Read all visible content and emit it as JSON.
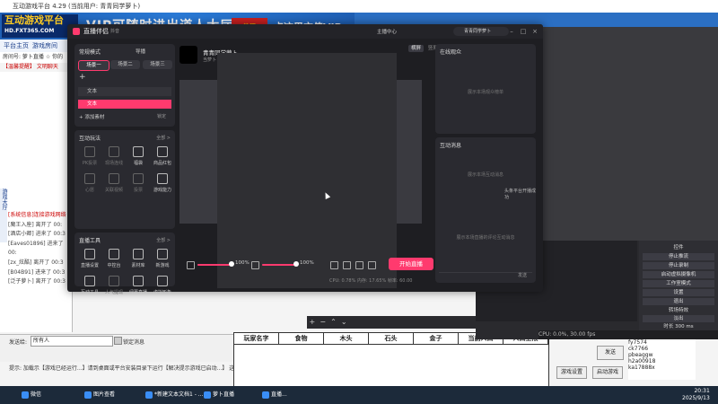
{
  "bg": {
    "window_title": "互动游戏平台 4.29 (当前用户: 青青同学萝卜)",
    "logo_text": "互动游戏平台",
    "logo_sub": "HD.FXT365.COM",
    "slogan": "VIP可随时进出道人大厅",
    "slogan_badge": "热门",
    "slogan_right": "点这里充值VIP",
    "nav_home": "平台主页",
    "nav_game": "游戏房间",
    "room_line": "房间号: 萝卜直播 ☆ 你的",
    "notice": "【温馨提醒】 文明聊天",
    "side_tab": "游戏大厅",
    "chat": [
      "[系统信息]连接游戏网络",
      "[魔王入座] 离开了 00:",
      "[酒店小卿] 进来了 00:3",
      "[Eaves01896] 进来了 00:",
      "[zx_炫酷] 离开了 00:3",
      "[B04B91] 进来了 00:3",
      "[泛子萝卜] 离开了 00:3"
    ],
    "send_target_label": "发送给:",
    "send_target_value": "所有人",
    "lock_label": "锁定消息",
    "tip": "提示: 加载示【游戏已经运行...】请到桌面或平台安装目录下运行【解决提示游戏已启动...】 这个文件",
    "score_headers": [
      "玩家名字",
      "食物",
      "木头",
      "石头",
      "金子",
      "当前人口",
      "人口上限"
    ],
    "obs_controls": [
      "控件",
      "停止推流",
      "停止录制",
      "启动虚拟摄像机",
      "工作室模式",
      "设置",
      "退出"
    ],
    "obs_status": "CPU: 0.0%, 30.00 fps",
    "obs_transition_label": "转场特效",
    "obs_transition_value": "淡出",
    "obs_duration": "时长 300 ms",
    "players": [
      "fy7574",
      "ck7766",
      "pbeaggw",
      "h2a00918",
      "ka17888x"
    ],
    "btn_game_settings": "游戏设置",
    "btn_start_game": "启动游戏",
    "btn_confirm": "发送"
  },
  "taskbar": {
    "items": [
      "微信",
      "图片查看",
      "*新建文本文档1 - ...",
      "萝卜直播",
      "直播..."
    ],
    "time": "20:31",
    "date": "2025/9/13"
  },
  "app": {
    "title": "直播伴侣",
    "version": "抖音",
    "creator_center": "主播中心",
    "user_name": "青青同学萝卜",
    "scene_mode": "常规模式",
    "guide": "导播",
    "scenes": [
      "场景一",
      "场景二",
      "场景三"
    ],
    "sources": [
      "文本",
      "文本"
    ],
    "add_material": "添加素材",
    "unlock": "锁定",
    "interact_title": "互动玩法",
    "all_label": "全部 >",
    "interact_items": [
      {
        "label": "PK投票",
        "dim": true
      },
      {
        "label": "现场连线",
        "dim": true
      },
      {
        "label": "福袋",
        "dim": false
      },
      {
        "label": "商品红包",
        "dim": false
      },
      {
        "label": "心愿",
        "dim": true
      },
      {
        "label": "关联视频",
        "dim": true
      },
      {
        "label": "投票",
        "dim": true
      },
      {
        "label": "游戏能力",
        "dim": false
      }
    ],
    "tools_title": "直播工具",
    "tools_items": [
      {
        "label": "直播设置",
        "dim": false
      },
      {
        "label": "中控台",
        "dim": false
      },
      {
        "label": "素材库",
        "dim": false
      },
      {
        "label": "新游戏",
        "dim": false
      },
      {
        "label": "互动工具",
        "dim": false
      },
      {
        "label": "人气提现",
        "dim": true
      },
      {
        "label": "绿幕直播",
        "dim": false
      },
      {
        "label": "虚拟形象",
        "dim": false
      }
    ],
    "stream_name": "青青同学萝卜",
    "stream_sub": "当萝卜",
    "mic_volume_label": "100%",
    "speaker_volume_label": "100%",
    "mic_volume": 1.0,
    "speaker_volume": 1.0,
    "go_live": "开始直播",
    "perf": "CPU: 0.78%  内存: 17.65%  帧率: 60.00",
    "viewers_title": "在线观众",
    "viewers_empty": "展示本场观众榜单",
    "messages_title": "互动消息",
    "messages_toast": "头条平台开播成功",
    "messages_empty": "展示本场直播的评论互动消息",
    "messages_empty_top": "展示本场互动消息",
    "send_mini": "发送",
    "landscape": "横屏",
    "portrait": "竖屏"
  }
}
